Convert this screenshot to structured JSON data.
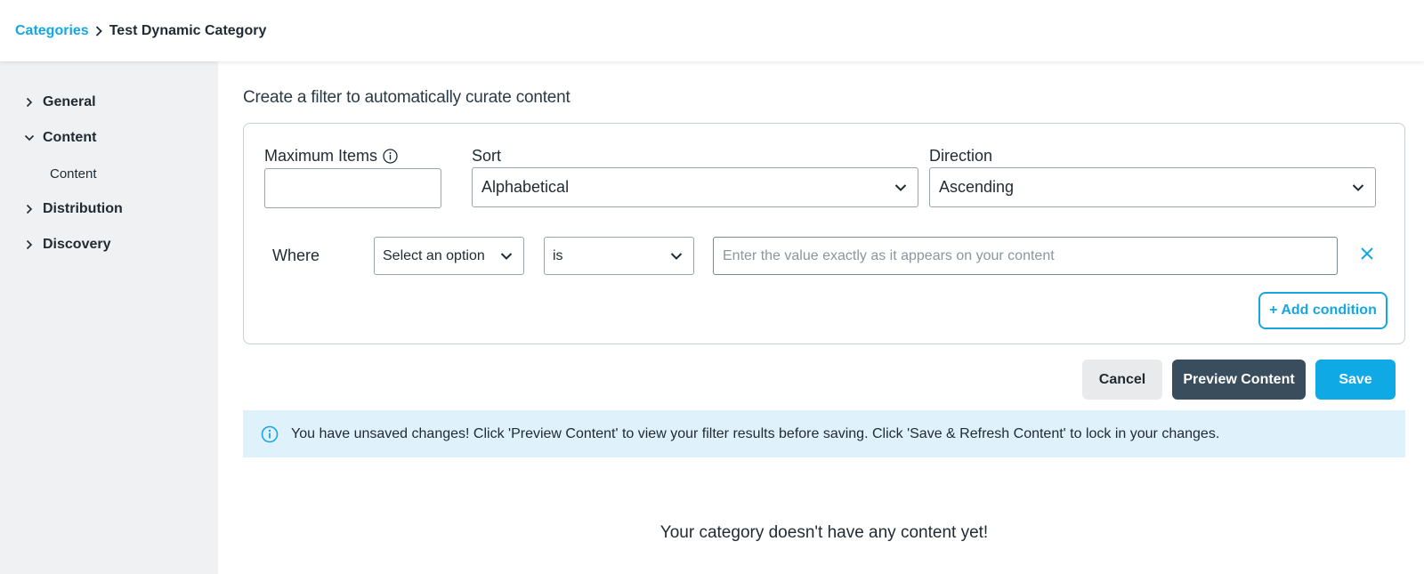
{
  "breadcrumb": {
    "parent": "Categories",
    "current": "Test Dynamic Category"
  },
  "sidebar": {
    "items": [
      {
        "label": "General",
        "expanded": false,
        "icon": "chevron-right-icon"
      },
      {
        "label": "Content",
        "expanded": true,
        "icon": "chevron-down-icon"
      },
      {
        "label": "Distribution",
        "expanded": false,
        "icon": "chevron-right-icon"
      },
      {
        "label": "Discovery",
        "expanded": false,
        "icon": "chevron-right-icon"
      }
    ],
    "sub_items": [
      {
        "label": "Content"
      }
    ]
  },
  "main": {
    "heading": "Create a filter to automatically curate content",
    "filter": {
      "max_items_label": "Maximum Items",
      "max_items_value": "",
      "sort_label": "Sort",
      "sort_value": "Alphabetical",
      "direction_label": "Direction",
      "direction_value": "Ascending",
      "where_label": "Where",
      "field_select": "Select an option",
      "operator_select": "is",
      "value_input": "",
      "value_placeholder": "Enter the value exactly as it appears on your content",
      "add_condition_label": "+ Add condition"
    },
    "actions": {
      "cancel_label": "Cancel",
      "preview_label": "Preview Content",
      "save_label": "Save"
    },
    "banner": {
      "text": "You have unsaved changes! Click 'Preview Content' to view your filter results before saving. Click 'Save & Refresh Content' to lock in your changes.",
      "icon": "info-icon"
    },
    "empty_state": "Your category doesn't have any content yet!"
  },
  "colors": {
    "accent": "#17a7e0",
    "dark_button": "#3a4d5c",
    "sidebar_bg": "#eff1f3",
    "banner_bg": "#dff1fa"
  }
}
